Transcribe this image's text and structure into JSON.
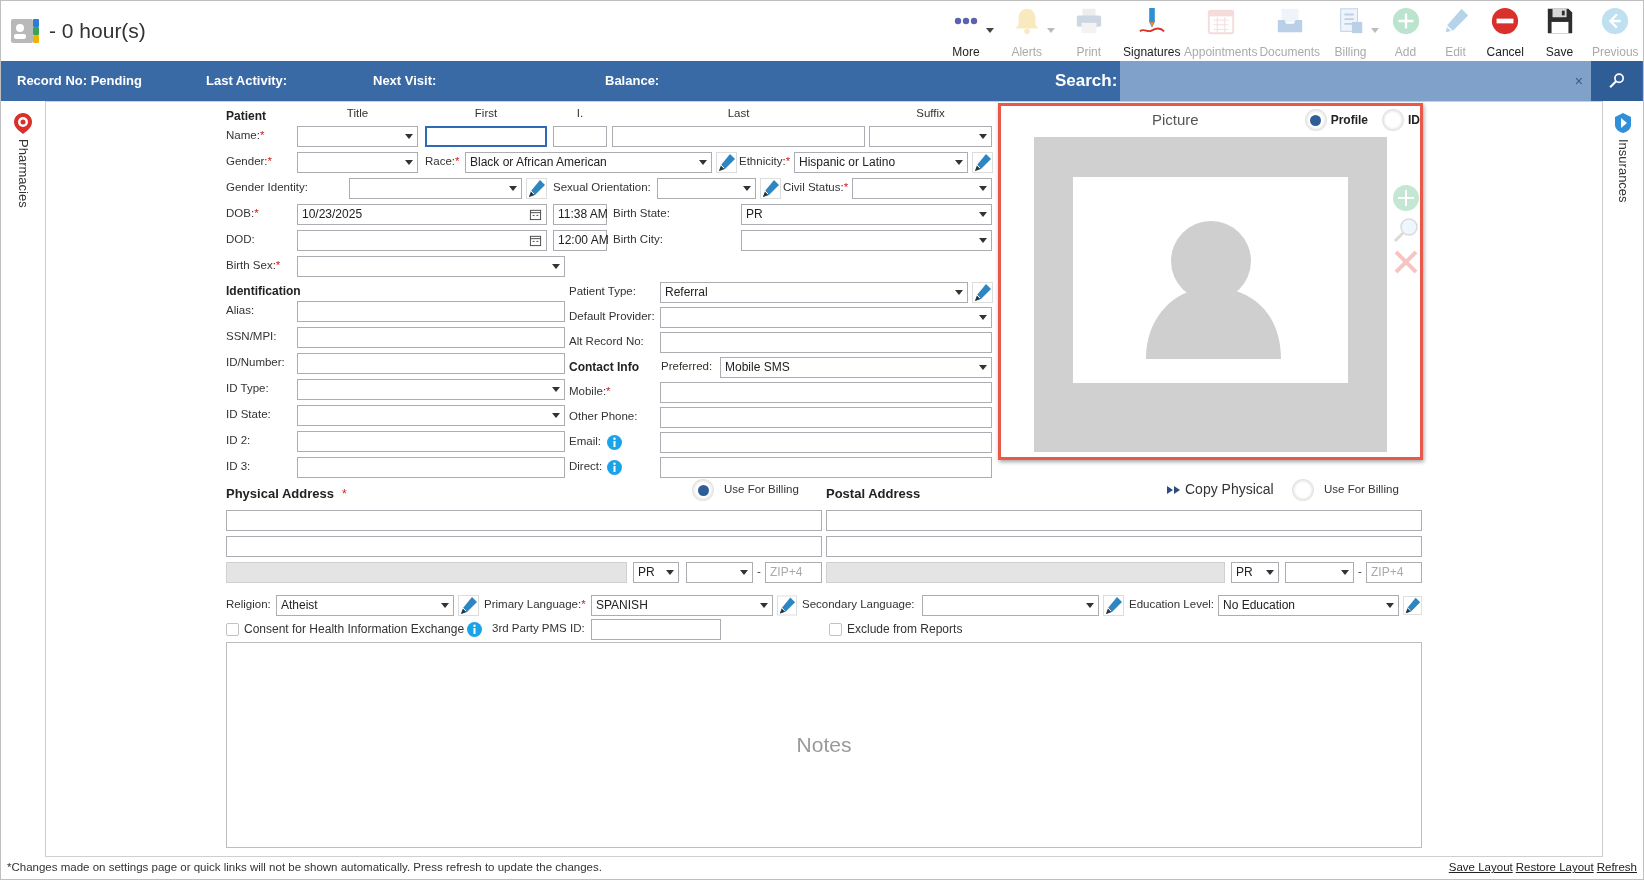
{
  "header": {
    "title": "- 0 hour(s)"
  },
  "toolbar": [
    {
      "kind": "more",
      "label": "More",
      "disabled": false,
      "dropdown": true
    },
    {
      "kind": "alerts",
      "label": "Alerts",
      "disabled": true,
      "dropdown": true
    },
    {
      "kind": "print",
      "label": "Print",
      "disabled": true,
      "dropdown": false
    },
    {
      "kind": "signatures",
      "label": "Signatures",
      "disabled": false,
      "dropdown": false
    },
    {
      "kind": "appointments",
      "label": "Appointments",
      "disabled": true,
      "dropdown": false
    },
    {
      "kind": "documents",
      "label": "Documents",
      "disabled": true,
      "dropdown": false
    },
    {
      "kind": "billing",
      "label": "Billing",
      "disabled": true,
      "dropdown": true
    },
    {
      "kind": "add",
      "label": "Add",
      "disabled": true,
      "dropdown": false
    },
    {
      "kind": "edit",
      "label": "Edit",
      "disabled": true,
      "dropdown": false
    },
    {
      "kind": "cancel",
      "label": "Cancel",
      "disabled": false,
      "dropdown": false
    },
    {
      "kind": "save",
      "label": "Save",
      "disabled": false,
      "dropdown": false
    },
    {
      "kind": "previous",
      "label": "Previous",
      "disabled": true,
      "dropdown": false
    }
  ],
  "info_bar": {
    "items": [
      "Record No: Pending",
      "Last Activity:",
      "Next Visit:",
      "Balance:"
    ],
    "search": {
      "label": "Search:",
      "clear": "×"
    }
  },
  "left_sidebar": {
    "tabs": [
      {
        "label": "Pharmacies"
      }
    ]
  },
  "right_sidebar": {
    "tabs": [
      {
        "label": "Insurances"
      }
    ]
  },
  "patient": {
    "heading": "Patient",
    "column_headers": [
      "Title",
      "First",
      "I.",
      "Last",
      "Suffix"
    ],
    "rows": [
      [
        {
          "kind": "label",
          "text": "Name:",
          "mark": "*"
        },
        {
          "kind": "select"
        },
        {
          "kind": "input",
          "focused": true
        },
        {
          "kind": "input",
          "focused": false
        },
        {
          "kind": "input",
          "focused": false
        },
        {
          "kind": "select"
        }
      ],
      [
        {
          "kind": "label",
          "text": "Gender:",
          "mark": "*"
        },
        {
          "kind": "select"
        },
        {
          "kind": "label",
          "text": "Race:",
          "mark": "*"
        },
        {
          "kind": "select",
          "value": "Black or African American"
        },
        {
          "kind": "edit"
        },
        {
          "kind": "label",
          "text": "Ethnicity:",
          "mark": "*"
        },
        {
          "kind": "select",
          "value": "Hispanic or Latino"
        },
        {
          "kind": "edit"
        }
      ],
      [
        {
          "kind": "label",
          "text": "Gender Identity:"
        },
        {
          "kind": "select"
        },
        {
          "kind": "edit"
        },
        {
          "kind": "label",
          "text": "Sexual Orientation:"
        },
        {
          "kind": "select"
        },
        {
          "kind": "edit"
        },
        {
          "kind": "label",
          "text": "Civil Status:",
          "mark": "*"
        },
        {
          "kind": "select"
        }
      ],
      [
        {
          "kind": "label",
          "text": "DOB:",
          "mark": "*"
        },
        {
          "kind": "date",
          "value": "10/23/2025"
        },
        {
          "kind": "time",
          "value": "11:38 AM"
        },
        {
          "kind": "label",
          "text": "Birth State:"
        },
        {
          "kind": "select",
          "value": "PR"
        }
      ],
      [
        {
          "kind": "label",
          "text": "DOD:"
        },
        {
          "kind": "date"
        },
        {
          "kind": "time",
          "value": "12:00 AM"
        },
        {
          "kind": "label",
          "text": "Birth City:"
        },
        {
          "kind": "select"
        }
      ],
      [
        {
          "kind": "label",
          "text": "Birth Sex:",
          "mark": "*"
        },
        {
          "kind": "select"
        }
      ]
    ]
  },
  "identification": {
    "heading": "Identification",
    "rows": [
      [
        {
          "kind": "label",
          "text": "Alias:"
        },
        {
          "kind": "input",
          "focused": false
        }
      ],
      [
        {
          "kind": "label",
          "text": "SSN/MPI:"
        },
        {
          "kind": "input",
          "focused": false
        }
      ],
      [
        {
          "kind": "label",
          "text": "ID/Number:"
        },
        {
          "kind": "input",
          "focused": false
        }
      ],
      [
        {
          "kind": "label",
          "text": "ID Type:"
        },
        {
          "kind": "select"
        }
      ],
      [
        {
          "kind": "label",
          "text": "ID State:"
        },
        {
          "kind": "select"
        }
      ],
      [
        {
          "kind": "label",
          "text": "ID 2:"
        },
        {
          "kind": "input",
          "focused": false
        }
      ],
      [
        {
          "kind": "label",
          "text": "ID 3:"
        },
        {
          "kind": "input",
          "focused": false
        }
      ]
    ]
  },
  "details": {
    "rows": [
      [
        {
          "kind": "label",
          "text": "Patient Type:"
        },
        {
          "kind": "select",
          "value": "Referral"
        },
        {
          "kind": "edit"
        }
      ],
      [
        {
          "kind": "label",
          "text": "Default Provider:"
        },
        {
          "kind": "select"
        }
      ],
      [
        {
          "kind": "label",
          "text": "Alt Record No:"
        },
        {
          "kind": "input",
          "focused": false
        }
      ],
      [
        {
          "kind": "heading",
          "text": "Contact Info"
        },
        {
          "kind": "label",
          "text": "Preferred:"
        },
        {
          "kind": "select",
          "value": "Mobile SMS"
        }
      ],
      [
        {
          "kind": "label",
          "text": "Mobile:",
          "mark": "*"
        },
        {
          "kind": "input",
          "focused": false
        }
      ],
      [
        {
          "kind": "label",
          "text": "Other Phone:"
        },
        {
          "kind": "input",
          "focused": false
        }
      ],
      [
        {
          "kind": "label",
          "text": "Email:"
        },
        {
          "kind": "info"
        },
        {
          "kind": "input",
          "focused": false
        }
      ],
      [
        {
          "kind": "label",
          "text": "Direct:"
        },
        {
          "kind": "info"
        },
        {
          "kind": "input",
          "focused": false
        }
      ]
    ]
  },
  "picture": {
    "title": "Picture",
    "highlighted": true,
    "options": [
      {
        "label": "Profile",
        "selected": true
      },
      {
        "label": "ID",
        "selected": false
      }
    ],
    "actions": [
      {
        "kind": "add",
        "disabled": true
      },
      {
        "kind": "zoom",
        "disabled": true
      },
      {
        "kind": "delete",
        "disabled": true
      }
    ]
  },
  "physical_address": {
    "title": "Physical Address",
    "mark": "*",
    "use_for_billing": {
      "label": "Use For Billing",
      "selected": true
    },
    "rows": [
      [
        {
          "kind": "input",
          "disabled": false
        }
      ],
      [
        {
          "kind": "input",
          "disabled": false
        }
      ],
      [
        {
          "kind": "input",
          "disabled": true
        },
        {
          "kind": "select",
          "value": "PR"
        },
        {
          "kind": "select"
        },
        {
          "kind": "dash",
          "text": "-"
        },
        {
          "kind": "input",
          "disabled": false,
          "placeholder": "ZIP+4"
        }
      ]
    ]
  },
  "postal_address": {
    "title": "Postal Address",
    "copy": "Copy Physical",
    "use_for_billing": {
      "label": "Use For Billing",
      "selected": false
    },
    "rows": [
      [
        {
          "kind": "input",
          "disabled": false
        }
      ],
      [
        {
          "kind": "input",
          "disabled": false
        }
      ],
      [
        {
          "kind": "input",
          "disabled": true
        },
        {
          "kind": "select",
          "value": "PR"
        },
        {
          "kind": "select"
        },
        {
          "kind": "dash",
          "text": "-"
        },
        {
          "kind": "input",
          "disabled": false,
          "placeholder": "ZIP+4"
        }
      ]
    ]
  },
  "extra_rows": [
    [
      {
        "kind": "label",
        "text": "Religion:"
      },
      {
        "kind": "select",
        "value": "Atheist"
      },
      {
        "kind": "edit"
      },
      {
        "kind": "label",
        "text": "Primary Language:",
        "mark": "*"
      },
      {
        "kind": "select",
        "value": "SPANISH"
      },
      {
        "kind": "edit"
      },
      {
        "kind": "label",
        "text": "Secondary Language:"
      },
      {
        "kind": "select"
      },
      {
        "kind": "edit"
      },
      {
        "kind": "label",
        "text": "Education Level:"
      },
      {
        "kind": "select",
        "value": "No Education"
      },
      {
        "kind": "edit"
      }
    ],
    [
      {
        "kind": "checkbox",
        "text": "Consent for Health Information Exchange",
        "checked": false
      },
      {
        "kind": "info"
      },
      {
        "kind": "label",
        "text": "3rd Party PMS ID:"
      },
      {
        "kind": "input",
        "focused": false
      },
      {
        "kind": "checkbox",
        "text": "Exclude from Reports",
        "checked": false
      }
    ]
  ],
  "notes": {
    "placeholder": "Notes"
  },
  "footer": {
    "note": "*Changes made on settings page or quick links will not be shown automatically. Press refresh to update the changes.",
    "links": [
      "Save Layout",
      "Restore Layout",
      "Refresh"
    ]
  }
}
